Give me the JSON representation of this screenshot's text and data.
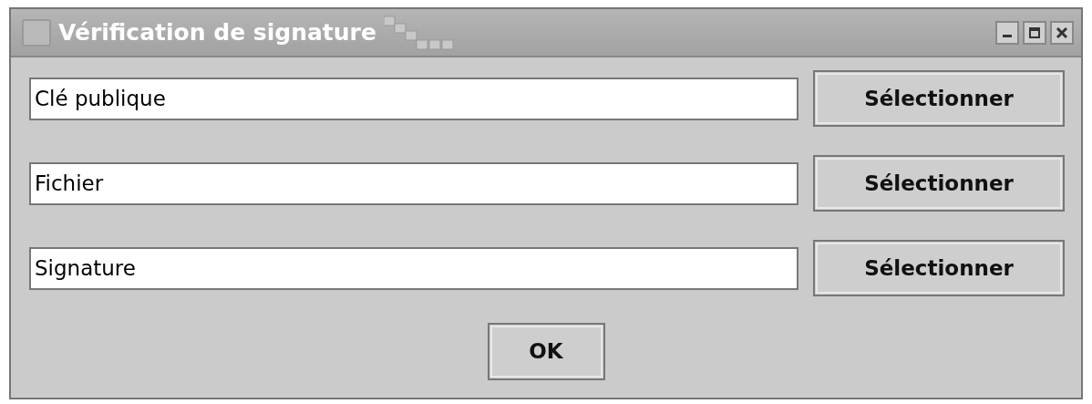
{
  "window": {
    "title": "Vérification de signature"
  },
  "rows": [
    {
      "value": "Clé publique",
      "button": "Sélectionner"
    },
    {
      "value": "Fichier",
      "button": "Sélectionner"
    },
    {
      "value": "Signature",
      "button": "Sélectionner"
    }
  ],
  "ok_button": "OK"
}
